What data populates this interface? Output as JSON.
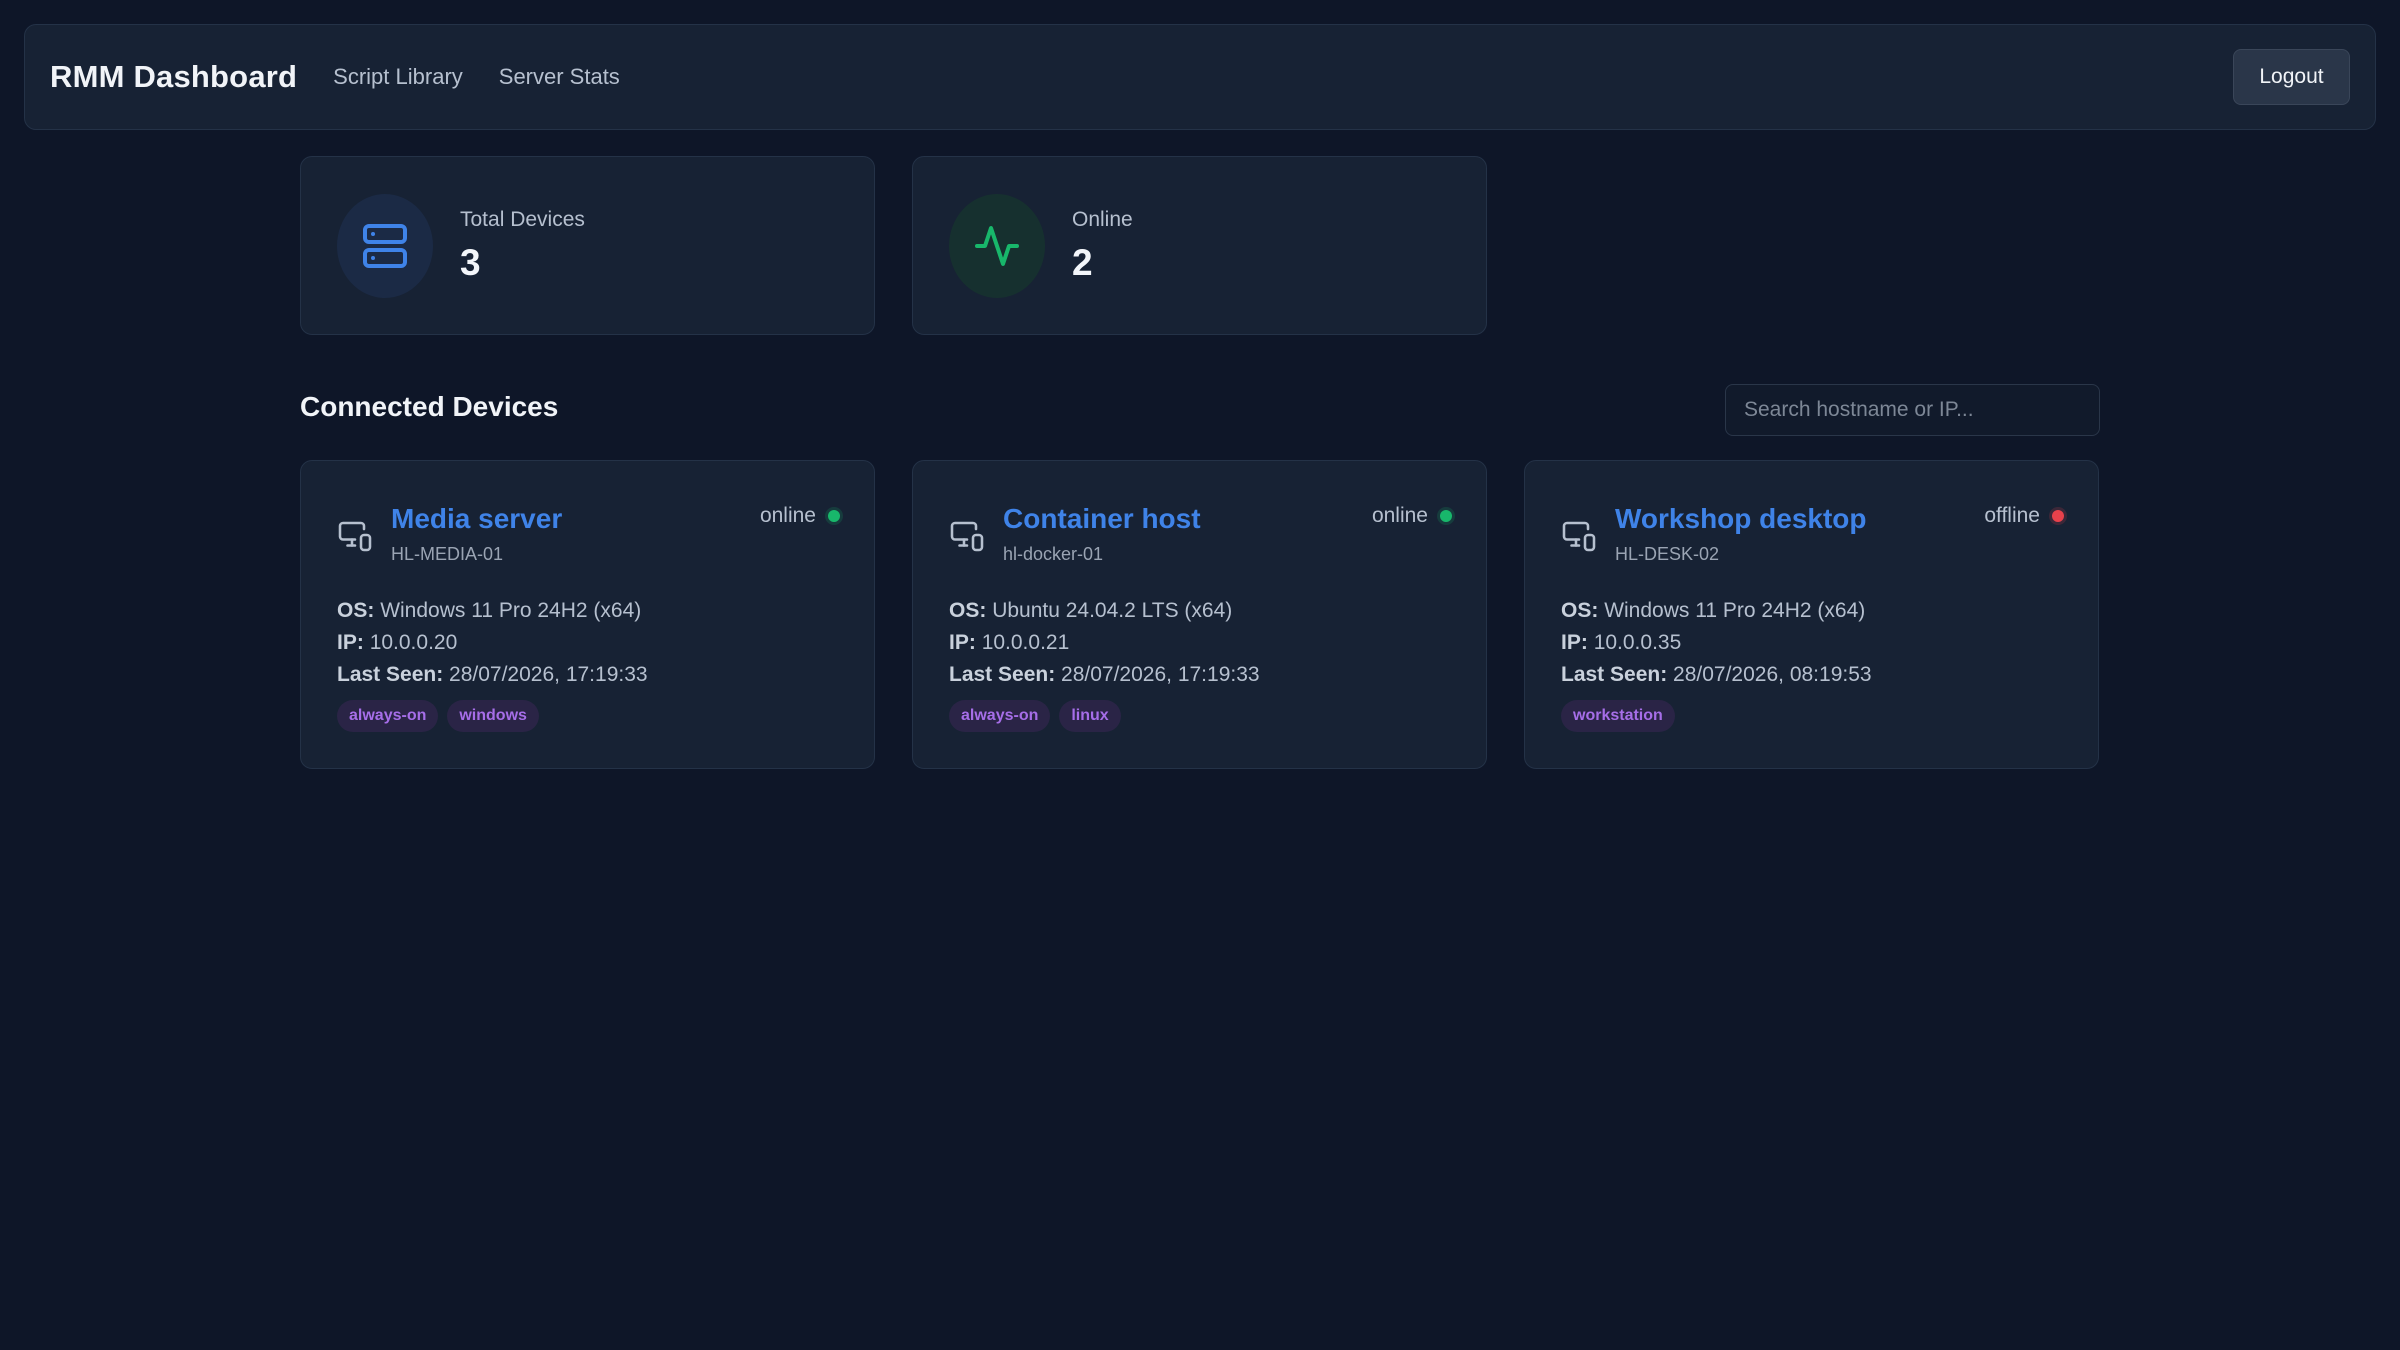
{
  "header": {
    "title": "RMM Dashboard",
    "nav": [
      {
        "label": "Script Library"
      },
      {
        "label": "Server Stats"
      }
    ],
    "logout_label": "Logout"
  },
  "stats": [
    {
      "label": "Total Devices",
      "value": "3",
      "icon": "server-icon",
      "color": "#3f83e8"
    },
    {
      "label": "Online",
      "value": "2",
      "icon": "activity-icon",
      "color": "#18b76b"
    }
  ],
  "devices_section": {
    "title": "Connected Devices",
    "search_placeholder": "Search hostname or IP..."
  },
  "field_labels": {
    "os": "OS:",
    "ip": "IP:",
    "last_seen": "Last Seen:"
  },
  "devices": [
    {
      "name": "Media server",
      "hostname": "HL-MEDIA-01",
      "status": "online",
      "os": "Windows 11 Pro 24H2 (x64)",
      "ip": "10.0.0.20",
      "last_seen": "28/07/2026, 17:19:33",
      "tags": [
        "always-on",
        "windows"
      ]
    },
    {
      "name": "Container host",
      "hostname": "hl-docker-01",
      "status": "online",
      "os": "Ubuntu 24.04.2 LTS (x64)",
      "ip": "10.0.0.21",
      "last_seen": "28/07/2026, 17:19:33",
      "tags": [
        "always-on",
        "linux"
      ]
    },
    {
      "name": "Workshop desktop",
      "hostname": "HL-DESK-02",
      "status": "offline",
      "os": "Windows 11 Pro 24H2 (x64)",
      "ip": "10.0.0.35",
      "last_seen": "28/07/2026, 08:19:53",
      "tags": [
        "workstation"
      ]
    }
  ],
  "colors": {
    "background": "#0e1628",
    "card": "#172234",
    "accent": "#3f83e8",
    "online": "#18b76b",
    "offline": "#e8414b",
    "tag_text": "#a66ee8"
  }
}
